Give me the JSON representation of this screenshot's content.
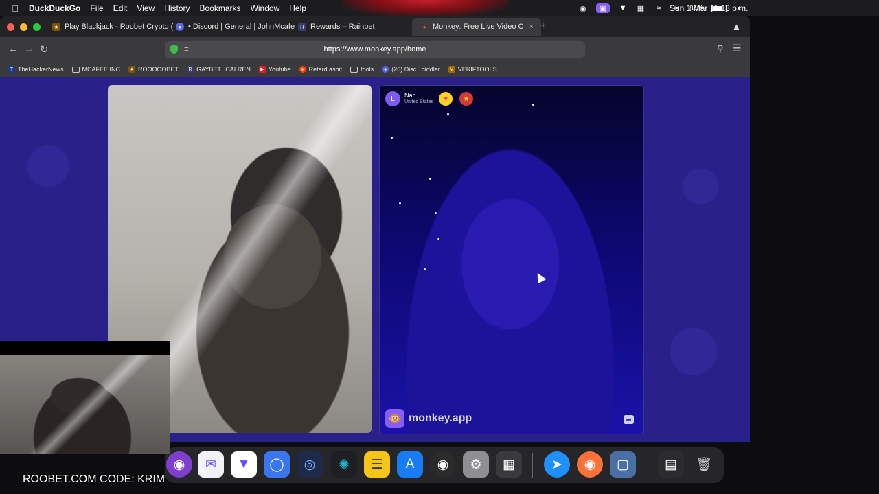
{
  "menubar": {
    "app_name": "DuckDuckGo",
    "menus": [
      "File",
      "Edit",
      "View",
      "History",
      "Bookmarks",
      "Window",
      "Help"
    ],
    "battery_percent": "84%",
    "battery_level": 0.84,
    "clock": "Sun 1 Mar  11:18 p.m."
  },
  "tabs": [
    {
      "label": "Play Blackjack - Roobet Crypto (",
      "icon": "roobet-icon"
    },
    {
      "label": "• Discord | General | JohnMcafe",
      "icon": "discord-icon"
    },
    {
      "label": "Rewards – Rainbet",
      "icon": "rainbet-icon"
    },
    {
      "label": "Monkey: Free Live Video C",
      "icon": "monkey-icon",
      "active": true
    }
  ],
  "address": {
    "url": "https://www.monkey.app/home"
  },
  "bookmarks": [
    {
      "label": "TheHackerNews",
      "icon": "thn-icon"
    },
    {
      "label": "MCAFEE INC",
      "icon": "folder-icon"
    },
    {
      "label": "ROOOOOBET",
      "icon": "roobet-icon"
    },
    {
      "label": "GAYBET...CALREN",
      "icon": "rainbet-icon"
    },
    {
      "label": "Youtube",
      "icon": "youtube-icon"
    },
    {
      "label": "Retard ashit",
      "icon": "reddit-icon"
    },
    {
      "label": "tools",
      "icon": "folder-icon"
    },
    {
      "label": "(20) Disc...diddler",
      "icon": "discord-icon"
    },
    {
      "label": "VERIFTOOLS",
      "icon": "veriftools-icon"
    }
  ],
  "peer": {
    "initial": "L",
    "name": "Nah",
    "country": "United States"
  },
  "brand": {
    "name": "monkey.app"
  },
  "dock_apps": [
    "tor-browser-icon",
    "mail-icon",
    "proton-vpn-icon",
    "signal-icon",
    "fingerprint-icon",
    "perplexity-icon",
    "notes-icon",
    "app-store-icon",
    "obs-icon",
    "system-settings-icon",
    "launchpad-icon",
    "safari-icon",
    "firefox-icon",
    "files-icon",
    "finder-window-icon",
    "trash-icon"
  ],
  "overlay": {
    "caption": "ROOBET.COM CODE: KRIM"
  }
}
